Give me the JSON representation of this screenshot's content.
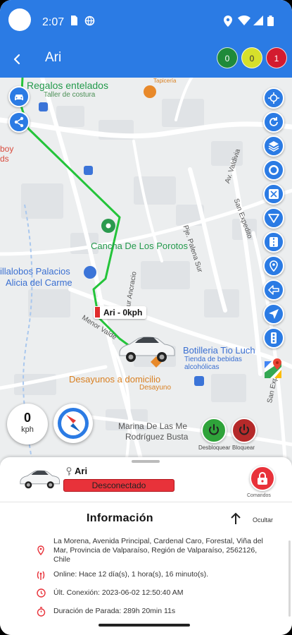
{
  "status_bar": {
    "time": "2:07",
    "icons": [
      "sim-card-icon",
      "vpn-icon",
      "location-icon",
      "wifi-icon",
      "signal-icon",
      "battery-icon"
    ]
  },
  "app_bar": {
    "title": "Ari",
    "badges": [
      {
        "label": "0",
        "color": "#1f8a3a",
        "text_color": "#ffffff"
      },
      {
        "label": "0",
        "color": "#d6e02b",
        "text_color": "#333333"
      },
      {
        "label": "1",
        "color": "#d31b2f",
        "text_color": "#ffffff"
      }
    ]
  },
  "map": {
    "labels": {
      "regalos": "Regalos entelados",
      "taller": "Taller de costura",
      "boy": "boy",
      "ds": "ds",
      "cancha": "Cancha De Los Porotos",
      "villalobos_1": "illalobos Palacios",
      "villalobos_2": "Alicia del Carme",
      "botilleria": "Botilleria Tio Luch",
      "tienda_1": "Tienda de bebidas",
      "tienda_2": "alcohólicas",
      "desayunos": "Desayunos a domicilio",
      "desayuno": "Desayuno",
      "marina_1": "Marina De Las Me",
      "marina_2": "Rodríguez Busta",
      "pje_palena": "Pje. Palena Sur",
      "av_valdivia": "Av. Valdivia",
      "san_expedito": "San Expedito",
      "san_ex_2": "San Expedito",
      "menor_valde": "Menor Valde",
      "sur_ancracio": "Sur Ancracio",
      "arauco": "Tapicería"
    },
    "car_label": "Ari - 0kph",
    "speed": {
      "value": "0",
      "unit": "kph"
    },
    "power_buttons": {
      "on_label": "Desbloquear",
      "off_label": "Bloquear"
    },
    "fab_icons": [
      "target-icon",
      "refresh-icon",
      "layers-icon",
      "circle-icon",
      "fullscreen-icon",
      "triangle-icon",
      "road-icon",
      "map-pin-icon",
      "signal-back-icon",
      "navigation-icon",
      "traffic-light-icon",
      "google-maps-icon"
    ]
  },
  "vehicle_panel": {
    "name": "Ari",
    "status": "Desconectado",
    "lock_label": "Comandos",
    "info_title": "Información",
    "hide_label": "Ocultar",
    "address": "La Morena, Avenida Principal, Cardenal Caro, Forestal, Viña del Mar, Provincia de Valparaíso, Región de Valparaíso, 2562126, Chile",
    "online": "Online: Hace 12 día(s), 1 hora(s), 16 minuto(s).",
    "last_connection": "Últ. Conexión: 2023-06-02 12:50:40 AM",
    "stop_duration": "Duración de Parada: 289h 20min 11s"
  }
}
